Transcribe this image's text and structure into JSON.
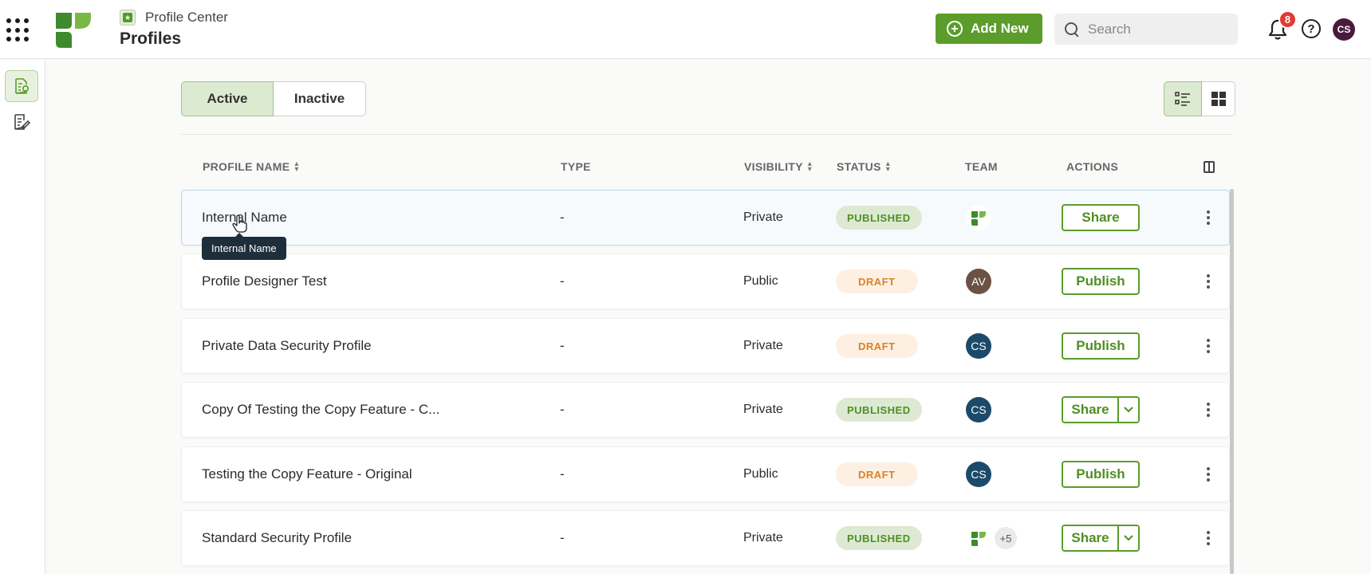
{
  "header": {
    "breadcrumb": "Profile Center",
    "title": "Profiles",
    "add_new_label": "Add New",
    "search_placeholder": "Search",
    "notification_count": "8",
    "user_initials": "CS",
    "help_glyph": "?"
  },
  "tabs": {
    "active": "Active",
    "inactive": "Inactive"
  },
  "columns": {
    "profile_name": "PROFILE NAME",
    "type": "TYPE",
    "visibility": "VISIBILITY",
    "status": "STATUS",
    "team": "TEAM",
    "actions": "ACTIONS"
  },
  "tooltip": "Internal Name",
  "rows": [
    {
      "name": "Internal Name",
      "type": "-",
      "visibility": "Private",
      "status": "PUBLISHED",
      "team": "logo",
      "action": "Share"
    },
    {
      "name": "Profile Designer Test",
      "type": "-",
      "visibility": "Public",
      "status": "DRAFT",
      "team": "AV",
      "action": "Publish"
    },
    {
      "name": "Private Data Security Profile",
      "type": "-",
      "visibility": "Private",
      "status": "DRAFT",
      "team": "CS",
      "action": "Publish"
    },
    {
      "name": "Copy Of Testing the Copy Feature - C...",
      "type": "-",
      "visibility": "Private",
      "status": "PUBLISHED",
      "team": "CS",
      "action": "Share"
    },
    {
      "name": "Testing the Copy Feature - Original",
      "type": "-",
      "visibility": "Public",
      "status": "DRAFT",
      "team": "CS",
      "action": "Publish"
    },
    {
      "name": "Standard Security Profile",
      "type": "-",
      "visibility": "Private",
      "status": "PUBLISHED",
      "team": "logo",
      "team_extra": "+5",
      "action": "Share"
    }
  ],
  "colors": {
    "brand_green": "#5b9c2a",
    "published_bg": "#dde9d3",
    "draft_text": "#d9822b",
    "avatar_cs": "#1b4a6b"
  }
}
